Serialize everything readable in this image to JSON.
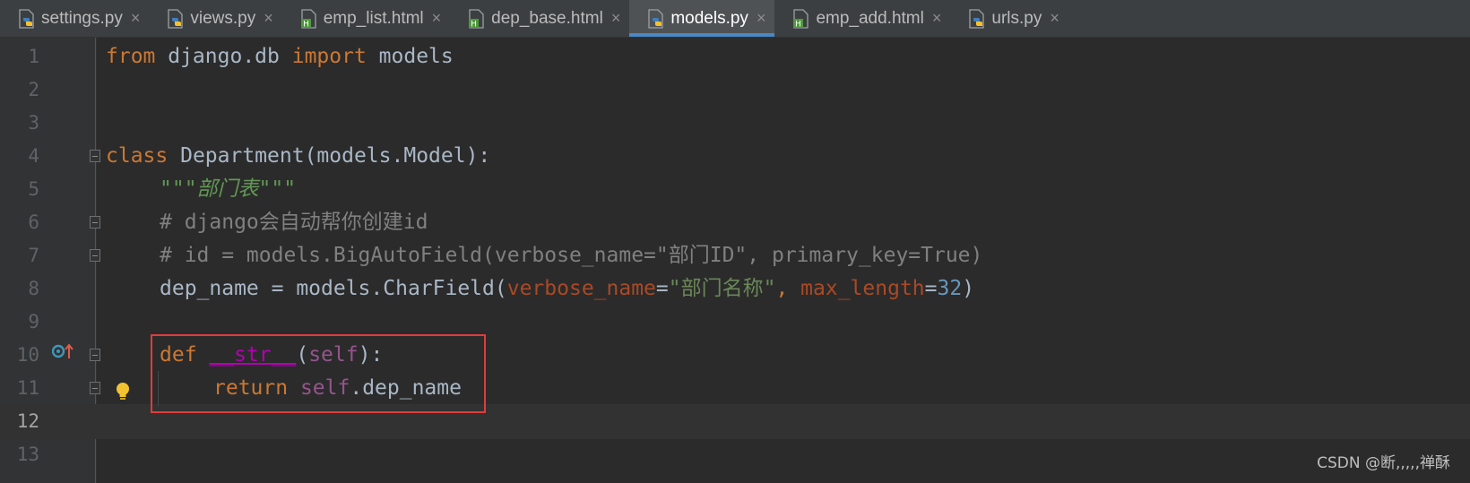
{
  "tabs": [
    {
      "label": "settings.py",
      "type": "python"
    },
    {
      "label": "views.py",
      "type": "python"
    },
    {
      "label": "emp_list.html",
      "type": "html"
    },
    {
      "label": "dep_base.html",
      "type": "html"
    },
    {
      "label": "models.py",
      "type": "python",
      "active": true
    },
    {
      "label": "emp_add.html",
      "type": "html"
    },
    {
      "label": "urls.py",
      "type": "python"
    }
  ],
  "close_glyph": "×",
  "line_numbers": [
    "1",
    "2",
    "3",
    "4",
    "5",
    "6",
    "7",
    "8",
    "9",
    "10",
    "11",
    "12",
    "13"
  ],
  "code": {
    "l1": {
      "kw1": "from",
      "mod": " django.db ",
      "kw2": "import",
      "name": " models"
    },
    "l4": {
      "kw": "class",
      "rest": " Department(models.Model):"
    },
    "l5": {
      "doc": "\"\"\"部门表\"\"\""
    },
    "l6": {
      "cmt": "# django会自动帮你创建id"
    },
    "l7": {
      "cmt": "# id = models.BigAutoField(verbose_name=\"部门ID\", primary_key=True)"
    },
    "l8": {
      "a": "dep_name = models.CharField(",
      "p1": "verbose_name",
      "eq1": "=",
      "s1": "\"部门名称\"",
      "comma": ", ",
      "p2": "max_length",
      "eq2": "=",
      "n": "32",
      "close": ")"
    },
    "l10": {
      "kw": "def",
      "sp": " ",
      "fn": "__str__",
      "open": "(",
      "self": "self",
      "close": "):"
    },
    "l11": {
      "kw": "return",
      "sp": " ",
      "self": "self",
      "rest": ".dep_name"
    }
  },
  "watermark": "CSDN @断,,,,,禅酥",
  "colors": {
    "background": "#2b2b2b",
    "gutter": "#313335",
    "keyword": "#cc7832",
    "string": "#6a8759",
    "comment": "#808080",
    "number": "#6897bb",
    "highlight_border": "#e23b3b",
    "active_tab_underline": "#4a88c7"
  }
}
